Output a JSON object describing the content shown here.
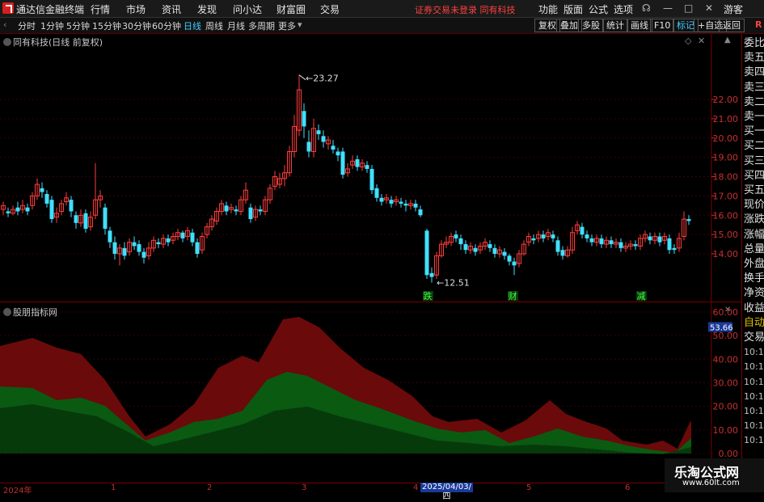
{
  "titlebar": {
    "app_name": "通达信金融终端",
    "menus": [
      "行情",
      "市场",
      "资讯",
      "发现",
      "问小达",
      "财富圈",
      "交易"
    ],
    "warning": "证券交易未登录  同有科技",
    "right_menus": [
      "功能",
      "版面",
      "公式",
      "选项"
    ],
    "user": "游客"
  },
  "toolbar": {
    "periods": [
      "分时",
      "1分钟",
      "5分钟",
      "15分钟",
      "30分钟",
      "60分钟",
      "日线",
      "周线",
      "月线",
      "多周期",
      "更多"
    ],
    "active_period": "日线",
    "buttons": [
      "复权",
      "叠加",
      "多股",
      "统计",
      "画线",
      "F10",
      "+自选",
      "返回"
    ]
  },
  "main_chart": {
    "title": "同有科技(日线 前复权)",
    "high_label": "23.27",
    "low_label": "12.51",
    "y_ticks": [
      "22.00",
      "21.00",
      "20.00",
      "19.00",
      "18.00",
      "17.00",
      "16.00",
      "15.00",
      "14.00"
    ],
    "markers": [
      "跌",
      "财",
      "减"
    ]
  },
  "indicator": {
    "title": "股朋指标网",
    "current_value": "53.66",
    "y_ticks": [
      "60.00",
      "50.00",
      "40.00",
      "30.00",
      "20.00",
      "10.00",
      "0.00"
    ]
  },
  "sidebar": {
    "labels": [
      "委比",
      "卖五",
      "卖四",
      "卖三",
      "卖二",
      "卖一",
      "买一",
      "买二",
      "买三",
      "买四",
      "买五",
      "现价",
      "涨跌",
      "涨幅",
      "总量",
      "外盘",
      "换手",
      "净资",
      "收益",
      "自动",
      "交易"
    ],
    "times": [
      "10:14",
      "10:14",
      "10:14",
      "10:14",
      "10:14",
      "10:14",
      "10:14"
    ]
  },
  "x_axis": {
    "labels": [
      "2024年",
      "1",
      "2",
      "3",
      "4",
      "5",
      "6"
    ],
    "cursor_date": "2025/04/03/四"
  },
  "watermark": {
    "line1": "乐淘公式网",
    "line2": "www.60lt.com"
  },
  "colors": {
    "up": "#ff3c3c",
    "down": "#40e0ff",
    "band_red": "#6a0a0a",
    "band_green": "#0a5a12",
    "band_dark_green": "#063a0b"
  }
}
